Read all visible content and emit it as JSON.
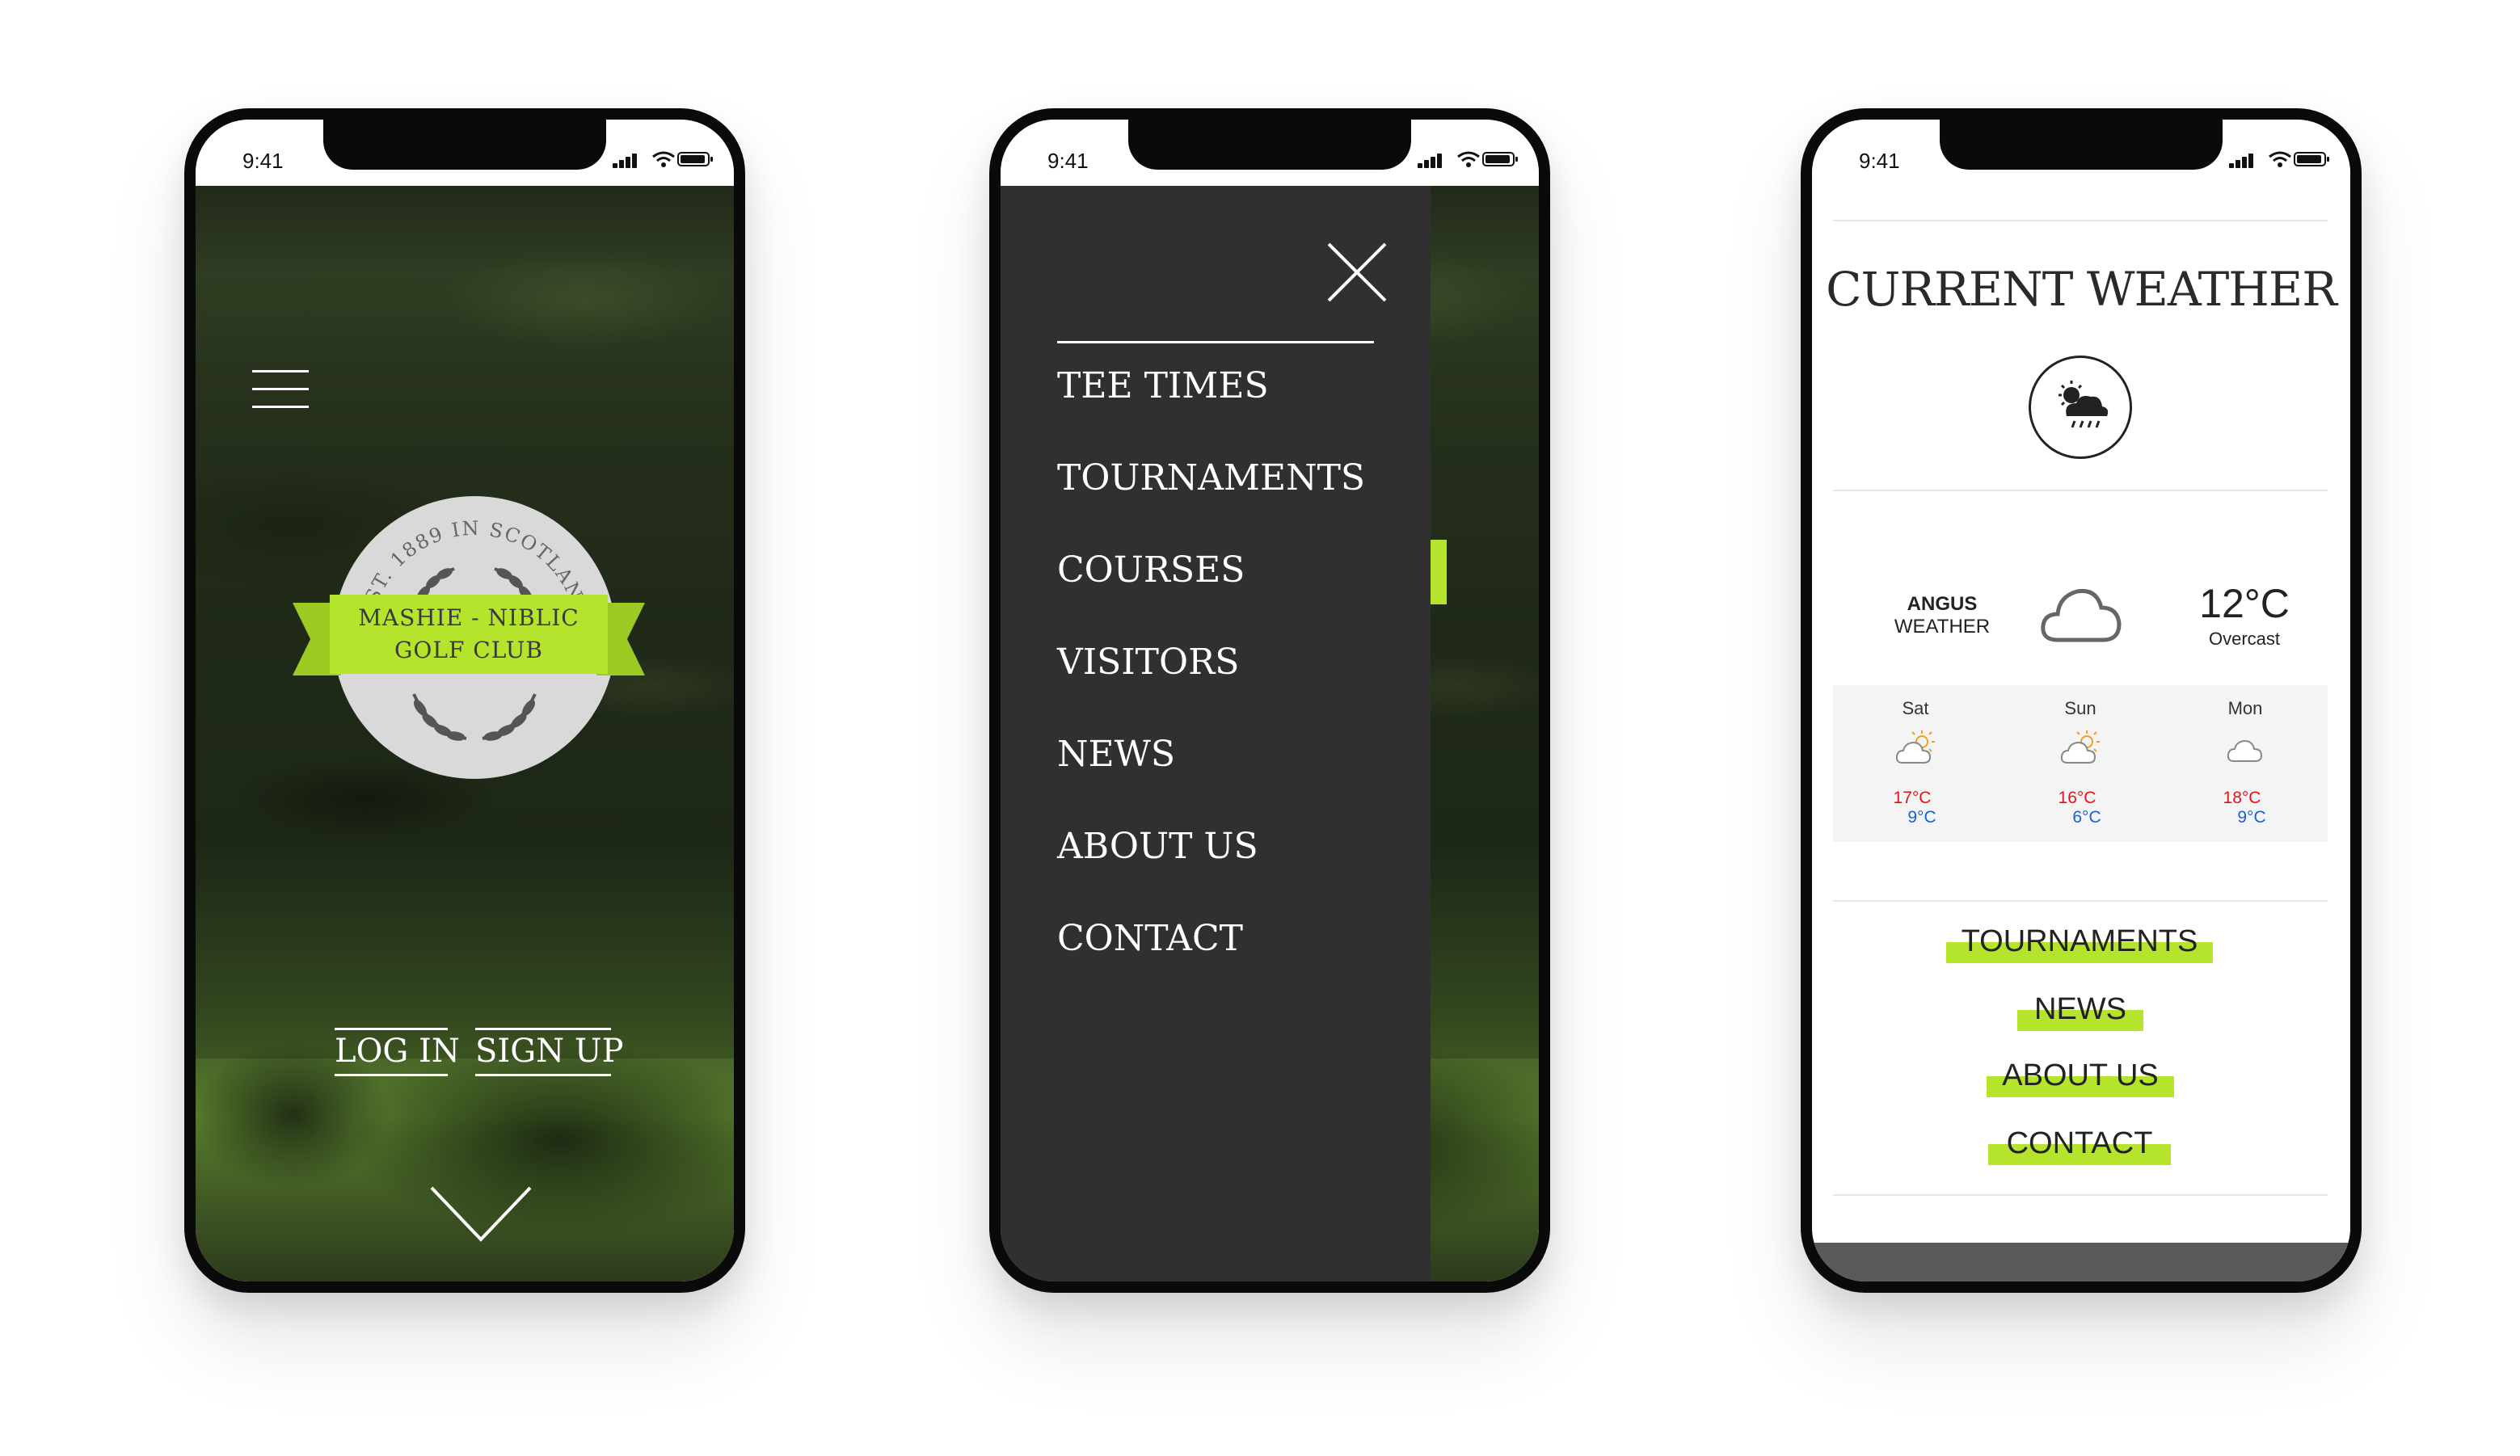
{
  "status": {
    "time": "9:41"
  },
  "home": {
    "logo": {
      "arc_text": "EST. 1889 IN SCOTLAND",
      "name_line1": "MASHIE - NIBLIC",
      "name_line2": "GOLF CLUB"
    },
    "login_label": "LOG IN",
    "signup_label": "SIGN UP",
    "icons": [
      "hamburger-icon",
      "chevron-down-icon"
    ]
  },
  "menu": {
    "items": [
      "TEE TIMES",
      "TOURNAMENTS",
      "COURSES",
      "VISITORS",
      "NEWS",
      "ABOUT US",
      "CONTACT"
    ],
    "icons": [
      "close-icon"
    ]
  },
  "weather": {
    "title": "CURRENT WEATHER",
    "place_line1": "ANGUS",
    "place_line2": "WEATHER",
    "temp": "12°C",
    "condition": "Overcast",
    "days": [
      {
        "name": "Sat",
        "high": "17°C",
        "low": "9°C",
        "icon": "sun-cloud-icon"
      },
      {
        "name": "Sun",
        "high": "16°C",
        "low": "6°C",
        "icon": "sun-cloud-icon"
      },
      {
        "name": "Mon",
        "high": "18°C",
        "low": "9°C",
        "icon": "cloud-icon"
      }
    ],
    "links": [
      "TOURNAMENTS",
      "NEWS",
      "ABOUT US",
      "CONTACT"
    ]
  },
  "colors": {
    "accent_green": "#b4e42b",
    "menu_bg": "#303030",
    "high_temp": "#e0141b",
    "low_temp": "#1b5fd6"
  }
}
